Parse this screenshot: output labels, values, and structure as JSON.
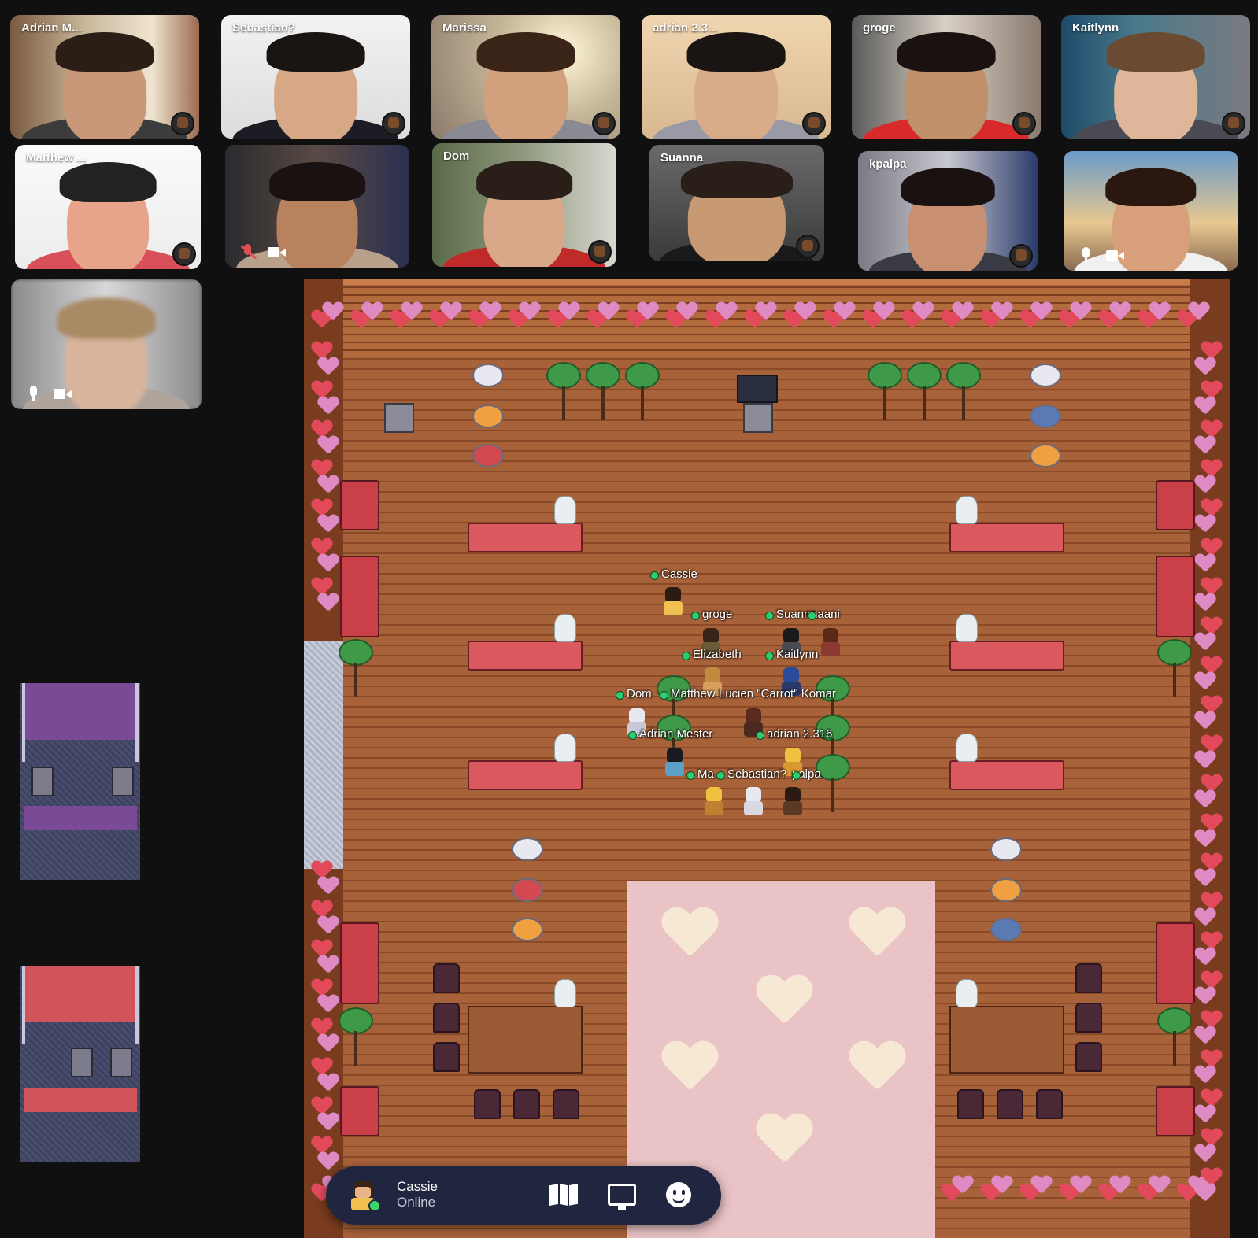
{
  "participants": [
    {
      "name": "Adrian M..."
    },
    {
      "name": "Sebastian?"
    },
    {
      "name": "Marissa"
    },
    {
      "name": "adrian 2.3..."
    },
    {
      "name": "groge"
    },
    {
      "name": "Kaitlynn"
    },
    {
      "name": "Matthew ..."
    },
    {
      "name": ""
    },
    {
      "name": "Dom"
    },
    {
      "name": "Suanna"
    },
    {
      "name": "kpalpa"
    },
    {
      "name": ""
    },
    {
      "name": ""
    }
  ],
  "map_players": {
    "cassie": "Cassie",
    "groge": "groge",
    "suanna": "Suanna",
    "maani": "maani",
    "elizabeth": "Elizabeth",
    "kaitlynn": "Kaitlynn",
    "dom": "Dom",
    "matthew": "Matthew Lucien \"Carrot\" Komar",
    "adrian_mester": "Adrian Mester",
    "adrian2": "adrian 2.316",
    "ma": "Ma",
    "sebastian": "Sebastian?",
    "kpalpa": "palpa"
  },
  "status_bar": {
    "user_name": "Cassie",
    "status": "Online",
    "map_icon": "map-icon",
    "screen_share_icon": "screen-share-icon",
    "emoji_icon": "emoji-icon"
  },
  "colors": {
    "background": "#101010",
    "status_bar": "#202540",
    "online": "#2ecc71",
    "rug": "#e9c3c5"
  }
}
